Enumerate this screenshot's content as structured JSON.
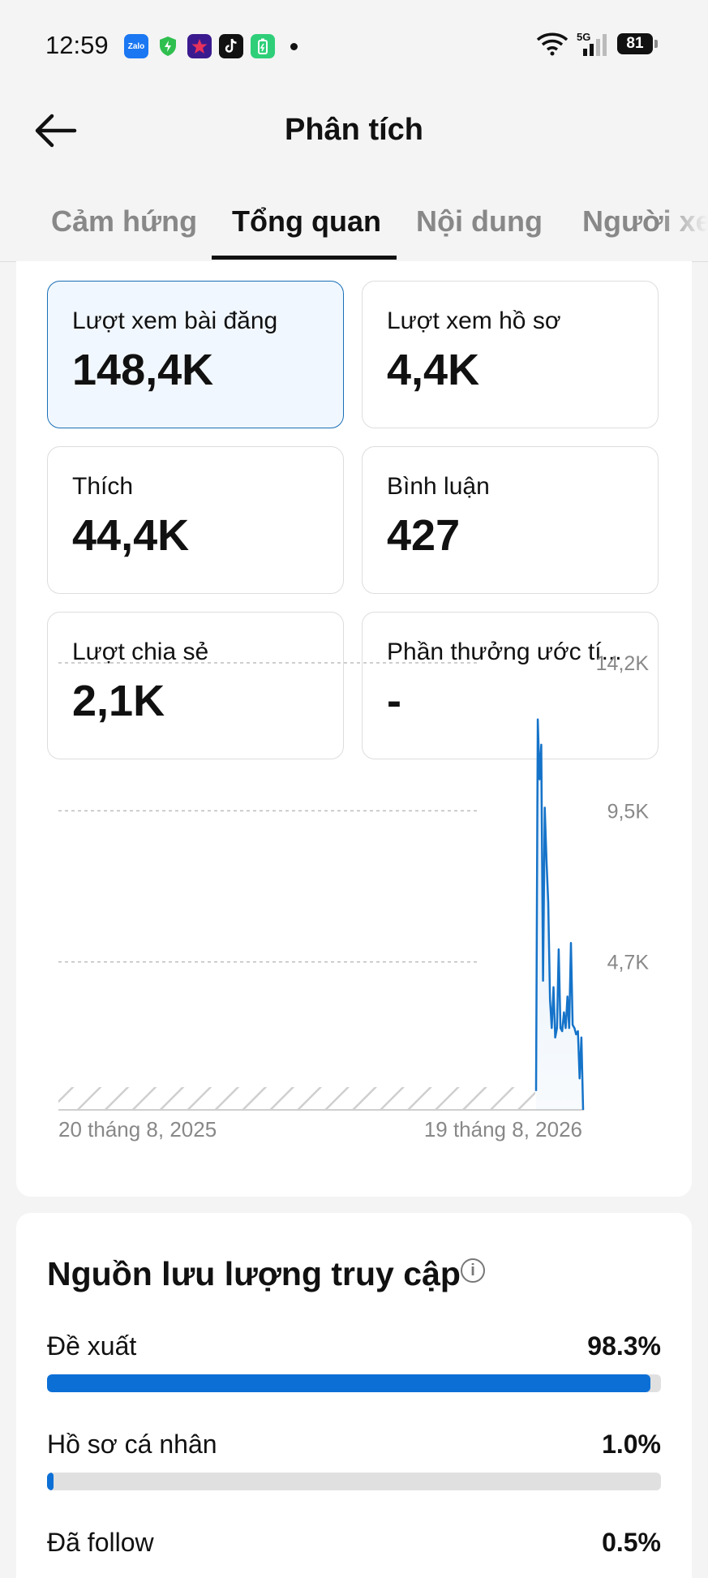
{
  "status_bar": {
    "time": "12:59",
    "battery": "81",
    "network": "5G"
  },
  "header": {
    "title": "Phân tích"
  },
  "tabs": [
    {
      "label": "Cảm hứng"
    },
    {
      "label": "Tổng quan"
    },
    {
      "label": "Nội dung"
    },
    {
      "label": "Người xe"
    }
  ],
  "metrics": [
    {
      "label": "Lượt xem bài đăng",
      "value": "148,4K"
    },
    {
      "label": "Lượt xem hồ sơ",
      "value": "4,4K"
    },
    {
      "label": "Thích",
      "value": "44,4K"
    },
    {
      "label": "Bình luận",
      "value": "427"
    },
    {
      "label": "Lượt chia sẻ",
      "value": "2,1K"
    },
    {
      "label": "Phần thưởng ước tí...",
      "value": "-"
    }
  ],
  "chart_data": {
    "type": "line",
    "ytick_labels": [
      "14,2K",
      "9,5K",
      "4,7K"
    ],
    "yticks": [
      14200,
      9500,
      4700
    ],
    "ylim": [
      0,
      14200
    ],
    "xtick_labels": [
      "20 tháng 8, 2025",
      "19 tháng 8, 2026"
    ],
    "no_data_region": "20 tháng 8, 2025 – early August 2026",
    "series": [
      {
        "values": [
          600,
          12400,
          10500,
          11600,
          4100,
          9600,
          7900,
          6600,
          3500,
          2600,
          3900,
          2300,
          2600,
          5100,
          2600,
          2500,
          3100,
          2600,
          3600,
          2600,
          5300,
          2700,
          2600,
          2400,
          2500,
          1000,
          2300,
          0
        ]
      }
    ],
    "grid": true,
    "color": "#1573c9"
  },
  "traffic": {
    "title": "Nguồn lưu lượng truy cập",
    "info_icon": "i",
    "sources": [
      {
        "label": "Đề xuất",
        "pct": "98.3%",
        "value": 0.983
      },
      {
        "label": "Hồ sơ cá nhân",
        "pct": "1.0%",
        "value": 0.01
      },
      {
        "label": "Đã follow",
        "pct": "0.5%",
        "value": 0.005
      }
    ]
  }
}
